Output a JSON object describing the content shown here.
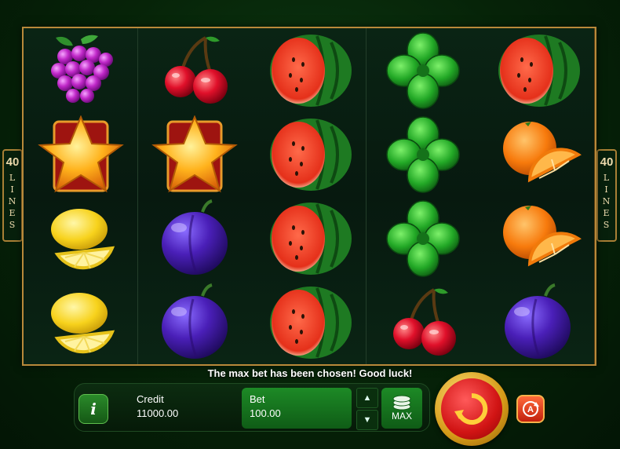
{
  "lines_badge": {
    "number": "40",
    "word": [
      "L",
      "I",
      "N",
      "E",
      "S"
    ]
  },
  "reels": [
    [
      "grapes",
      "star",
      "lemon",
      "lemon"
    ],
    [
      "cherries",
      "star",
      "plum",
      "plum"
    ],
    [
      "watermelon",
      "watermelon",
      "watermelon",
      "watermelon"
    ],
    [
      "clover",
      "clover",
      "clover",
      "cherries"
    ],
    [
      "watermelon",
      "orange",
      "orange",
      "plum"
    ]
  ],
  "message": "The max bet has been chosen! Good luck!",
  "info_button": {
    "label": "i"
  },
  "credit": {
    "label": "Credit",
    "value": "11000.00"
  },
  "bet": {
    "label": "Bet",
    "value": "100.00"
  },
  "bet_up_icon": "triangle-up-icon",
  "bet_down_icon": "triangle-down-icon",
  "max_button": {
    "label": "MAX",
    "icon": "coin-stack-icon"
  },
  "spin_button": {
    "icon": "spin-arrows-icon"
  },
  "autoplay_button": {
    "label": "A",
    "icon": "autoplay-icon"
  },
  "colors": {
    "frame": "#b8893a",
    "background": "#062308",
    "spin": "#d11414",
    "button_green": "#1d8a26"
  }
}
